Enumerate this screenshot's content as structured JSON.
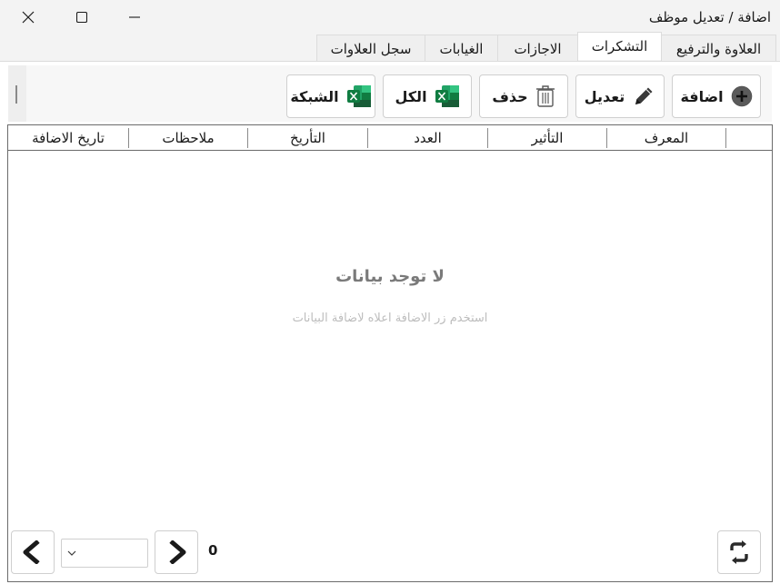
{
  "window": {
    "title": "اضافة / تعديل موظف"
  },
  "tabs": [
    {
      "label": "العلاوة والترفيع"
    },
    {
      "label": "التشكرات"
    },
    {
      "label": "الاجازات"
    },
    {
      "label": "الغيابات"
    },
    {
      "label": "سجل العلاوات"
    }
  ],
  "active_tab": "التشكرات",
  "toolbar": {
    "add_label": "اضافة",
    "edit_label": "تعديل",
    "delete_label": "حذف",
    "export_all_label": "الكل",
    "export_grid_label": "الشبكة",
    "icons": [
      "add-circle-icon",
      "pencil-icon",
      "trash-icon",
      "excel-icon",
      "excel-icon"
    ]
  },
  "grid": {
    "columns": [
      "المعرف",
      "التأثير",
      "العدد",
      "التأريخ",
      "ملاحظات",
      "تاريخ الاضافة"
    ],
    "rows": []
  },
  "empty_state": {
    "title": "لا توجد بيانات",
    "subtitle": "استخدم زر الاضافة اعلاه لاضافة البيانات"
  },
  "pagination": {
    "count": "0",
    "page_value": ""
  },
  "colors": {
    "excel_green": "#1e7145",
    "border": "#cfcfcf",
    "empty_text": "#7a7a7a"
  }
}
